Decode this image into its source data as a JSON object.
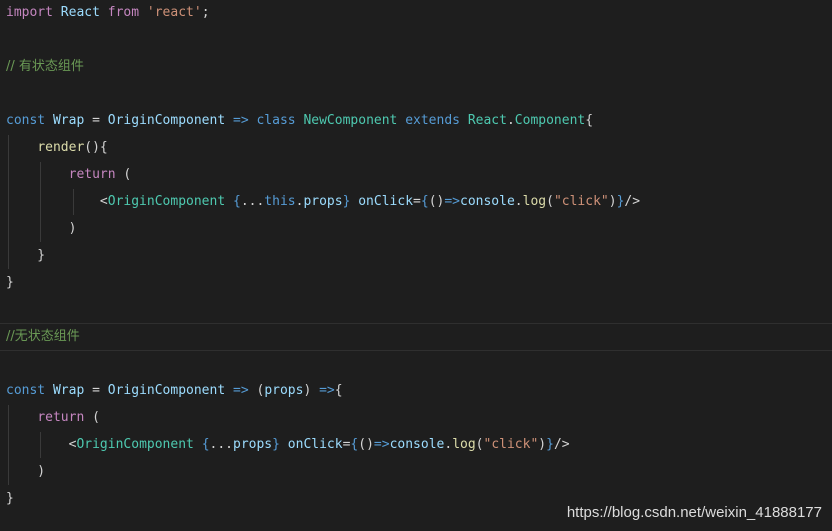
{
  "colors": {
    "background": "#1e1e1e",
    "keyword": "#569cd6",
    "control": "#c586c0",
    "string": "#ce9178",
    "comment": "#6a9955",
    "variable": "#9cdcfe",
    "class": "#4ec9b0",
    "function": "#dcdcaa",
    "plain": "#d4d4d4"
  },
  "code_lines": [
    [
      [
        "import",
        "ctrl"
      ],
      [
        " ",
        "op"
      ],
      [
        "React",
        "var"
      ],
      [
        " ",
        "op"
      ],
      [
        "from",
        "ctrl"
      ],
      [
        " ",
        "op"
      ],
      [
        "'react'",
        "str"
      ],
      [
        ";",
        "op"
      ]
    ],
    [],
    [
      [
        "// 有状态组件",
        "cm"
      ]
    ],
    [],
    [
      [
        "const",
        "kw"
      ],
      [
        " ",
        "op"
      ],
      [
        "Wrap",
        "var"
      ],
      [
        " = ",
        "op"
      ],
      [
        "OriginComponent",
        "var"
      ],
      [
        " ",
        "op"
      ],
      [
        "=>",
        "kw"
      ],
      [
        " ",
        "op"
      ],
      [
        "class",
        "kw"
      ],
      [
        " ",
        "op"
      ],
      [
        "NewComponent",
        "cls"
      ],
      [
        " ",
        "op"
      ],
      [
        "extends",
        "kw"
      ],
      [
        " ",
        "op"
      ],
      [
        "React",
        "cls"
      ],
      [
        ".",
        "op"
      ],
      [
        "Component",
        "cls"
      ],
      [
        "{",
        "op"
      ]
    ],
    [
      [
        "    ",
        "op"
      ],
      [
        "render",
        "fn"
      ],
      [
        "(){",
        "op"
      ]
    ],
    [
      [
        "        ",
        "op"
      ],
      [
        "return",
        "ctrl"
      ],
      [
        " (",
        "op"
      ]
    ],
    [
      [
        "            ",
        "op"
      ],
      [
        "<",
        "op"
      ],
      [
        "OriginComponent",
        "cls"
      ],
      [
        " ",
        "op"
      ],
      [
        "{",
        "kw"
      ],
      [
        "...",
        "op"
      ],
      [
        "this",
        "kw"
      ],
      [
        ".",
        "op"
      ],
      [
        "props",
        "var"
      ],
      [
        "}",
        "kw"
      ],
      [
        " ",
        "op"
      ],
      [
        "onClick",
        "var"
      ],
      [
        "=",
        "op"
      ],
      [
        "{",
        "kw"
      ],
      [
        "()",
        "op"
      ],
      [
        "=>",
        "kw"
      ],
      [
        "console",
        "var"
      ],
      [
        ".",
        "op"
      ],
      [
        "log",
        "fn"
      ],
      [
        "(",
        "op"
      ],
      [
        "\"click\"",
        "str"
      ],
      [
        ")",
        "op"
      ],
      [
        "}",
        "kw"
      ],
      [
        "/>",
        "op"
      ]
    ],
    [
      [
        "        )",
        "op"
      ]
    ],
    [
      [
        "    }",
        "op"
      ]
    ],
    [
      [
        "}",
        "op"
      ]
    ],
    [],
    [
      [
        "//无状态组件",
        "cm"
      ]
    ],
    [],
    [
      [
        "const",
        "kw"
      ],
      [
        " ",
        "op"
      ],
      [
        "Wrap",
        "var"
      ],
      [
        " = ",
        "op"
      ],
      [
        "OriginComponent",
        "var"
      ],
      [
        " ",
        "op"
      ],
      [
        "=>",
        "kw"
      ],
      [
        " (",
        "op"
      ],
      [
        "props",
        "var"
      ],
      [
        ") ",
        "op"
      ],
      [
        "=>",
        "kw"
      ],
      [
        "{",
        "op"
      ]
    ],
    [
      [
        "    ",
        "op"
      ],
      [
        "return",
        "ctrl"
      ],
      [
        " (",
        "op"
      ]
    ],
    [
      [
        "        ",
        "op"
      ],
      [
        "<",
        "op"
      ],
      [
        "OriginComponent",
        "cls"
      ],
      [
        " ",
        "op"
      ],
      [
        "{",
        "kw"
      ],
      [
        "...",
        "op"
      ],
      [
        "props",
        "var"
      ],
      [
        "}",
        "kw"
      ],
      [
        " ",
        "op"
      ],
      [
        "onClick",
        "var"
      ],
      [
        "=",
        "op"
      ],
      [
        "{",
        "kw"
      ],
      [
        "()",
        "op"
      ],
      [
        "=>",
        "kw"
      ],
      [
        "console",
        "var"
      ],
      [
        ".",
        "op"
      ],
      [
        "log",
        "fn"
      ],
      [
        "(",
        "op"
      ],
      [
        "\"click\"",
        "str"
      ],
      [
        ")",
        "op"
      ],
      [
        "}",
        "kw"
      ],
      [
        "/>",
        "op"
      ]
    ],
    [
      [
        "    )",
        "op"
      ]
    ],
    [
      [
        "}",
        "op"
      ]
    ]
  ],
  "watermark": "https://blog.csdn.net/weixin_41888177"
}
